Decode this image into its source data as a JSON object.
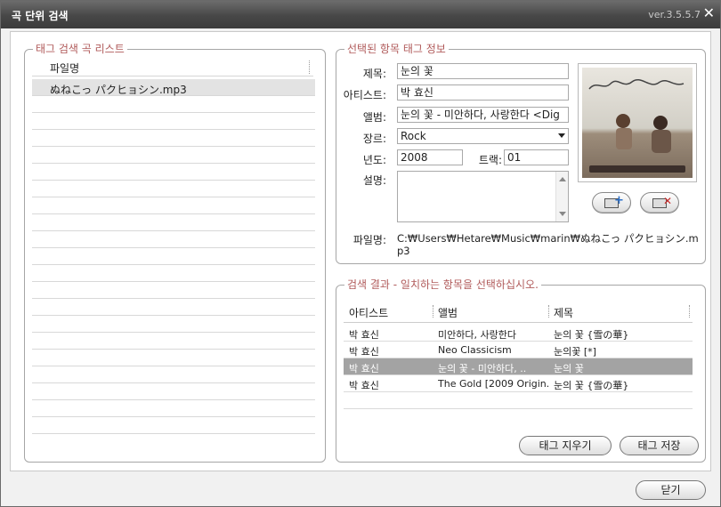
{
  "window": {
    "title": "곡 단위 검색",
    "version": "ver.3.5.5.7",
    "close_glyph": "✕"
  },
  "file_list": {
    "legend": "태그 검색 곡 리스트",
    "column_header": "파일명",
    "files": [
      "ぬねこっ パクヒョシン.mp3"
    ]
  },
  "tag_info": {
    "legend": "선택된 항목 태그 정보",
    "title_label": "제목:",
    "title_value": "눈의 꽃",
    "artist_label": "아티스트:",
    "artist_value": "박 효신",
    "album_label": "앨범:",
    "album_value": "눈의 꽃 - 미안하다, 사랑한다 <Dig",
    "genre_label": "장르:",
    "genre_value": "Rock",
    "year_label": "년도:",
    "year_value": "2008",
    "track_label": "트랙:",
    "track_value": "01",
    "comment_label": "설명:",
    "comment_value": "",
    "filename_label": "파일명:",
    "filename_value": "C:₩Users₩Hetare₩Music₩marin₩ぬねこっ パクヒョシン.mp3",
    "art_icons": [
      "add-cover-icon",
      "delete-cover-icon"
    ]
  },
  "results": {
    "legend": "검색 결과 - 일치하는 항목을 선택하십시오.",
    "columns": [
      "아티스트",
      "앨범",
      "제목"
    ],
    "rows": [
      {
        "artist": "박 효신",
        "album": "미안하다, 사랑한다",
        "title": "눈의 꽃 {雪の華}"
      },
      {
        "artist": "박 효신",
        "album": "Neo Classicism",
        "title": "눈의꽃 [*]"
      },
      {
        "artist": "박 효신",
        "album": "눈의 꽃 - 미안하다, ..",
        "title": "눈의 꽃"
      },
      {
        "artist": "박 효신",
        "album": "The Gold [2009 Origin...",
        "title": "눈의 꽃 {雪の華}"
      }
    ],
    "selected_index": 2,
    "clear_tags_label": "태그 지우기",
    "save_tags_label": "태그 저장"
  },
  "footer": {
    "close_label": "닫기"
  },
  "colors": {
    "legend_text": "#b05a5a",
    "title_bar": "#474747",
    "selected_row": "#a3a3a3"
  }
}
